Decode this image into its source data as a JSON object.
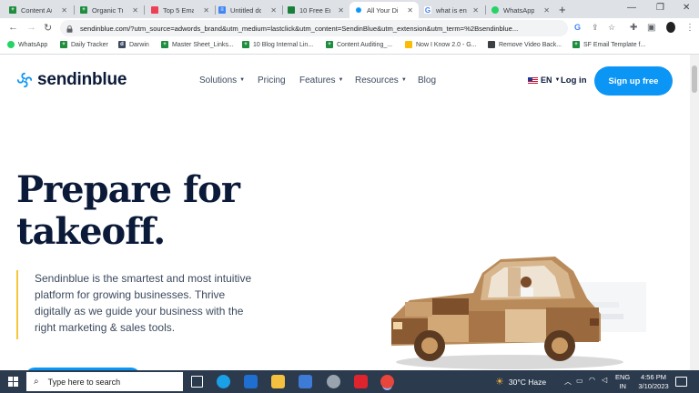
{
  "browser": {
    "tabs": [
      {
        "label": "Content Au",
        "icon": "google-sheets-icon",
        "color": "#1e8e3e"
      },
      {
        "label": "Organic Tra",
        "icon": "google-sheets-icon",
        "color": "#1e8e3e"
      },
      {
        "label": "Top 5 Emai",
        "icon": "pocket-icon",
        "color": "#ef3f56"
      },
      {
        "label": "Untitled do",
        "icon": "google-docs-icon",
        "color": "#4285f4"
      },
      {
        "label": "10 Free Em",
        "icon": "sheets-icon",
        "color": "#188038"
      },
      {
        "label": "All Your Di",
        "icon": "sendinblue-icon",
        "color": "#0b96f5",
        "active": true
      },
      {
        "label": "what is ent",
        "icon": "google-icon",
        "color": "#4285f4"
      },
      {
        "label": "WhatsApp",
        "icon": "whatsapp-icon",
        "color": "#25d366"
      }
    ],
    "url": "sendinblue.com/?utm_source=adwords_brand&utm_medium=lastclick&utm_content=SendinBlue&utm_extension&utm_term=%2Bsendinblue...",
    "bookmarks": [
      {
        "label": "WhatsApp",
        "icon": "whatsapp-icon",
        "color": "#25d366"
      },
      {
        "label": "Daily Tracker",
        "icon": "google-sheets-icon",
        "color": "#1e8e3e"
      },
      {
        "label": "Darwin",
        "icon": "darwin-icon",
        "color": "#3c4a5e"
      },
      {
        "label": "Master Sheet_Links...",
        "icon": "google-sheets-icon",
        "color": "#1e8e3e"
      },
      {
        "label": "10 Blog Internal Lin...",
        "icon": "google-sheets-icon",
        "color": "#1e8e3e"
      },
      {
        "label": "Content Auditing_...",
        "icon": "google-sheets-icon",
        "color": "#1e8e3e"
      },
      {
        "label": "Now I Know 2.0 - G...",
        "icon": "google-drive-icon",
        "color": "#fbbc04"
      },
      {
        "label": "Remove Video Back...",
        "icon": "video-icon",
        "color": "#3c4043"
      },
      {
        "label": "SF Email Template f...",
        "icon": "google-sheets-icon",
        "color": "#1e8e3e"
      }
    ]
  },
  "site": {
    "brand": "sendinblue",
    "nav": [
      "Solutions",
      "Pricing",
      "Features",
      "Resources",
      "Blog"
    ],
    "lang": "EN",
    "login": "Log in",
    "signup": "Sign up free",
    "headline": "Prepare for takeoff.",
    "description": "Sendinblue is the smartest and most intuitive platform for growing businesses. Thrive digitally as we guide your business with the right marketing & sales tools.",
    "accent_color": "#0b96f5",
    "navy": "#0b1a38"
  },
  "taskbar": {
    "search_placeholder": "Type here to search",
    "weather": "30°C  Haze",
    "lang": "ENG",
    "region": "IN",
    "time": "4:56 PM",
    "date": "3/10/2023"
  }
}
